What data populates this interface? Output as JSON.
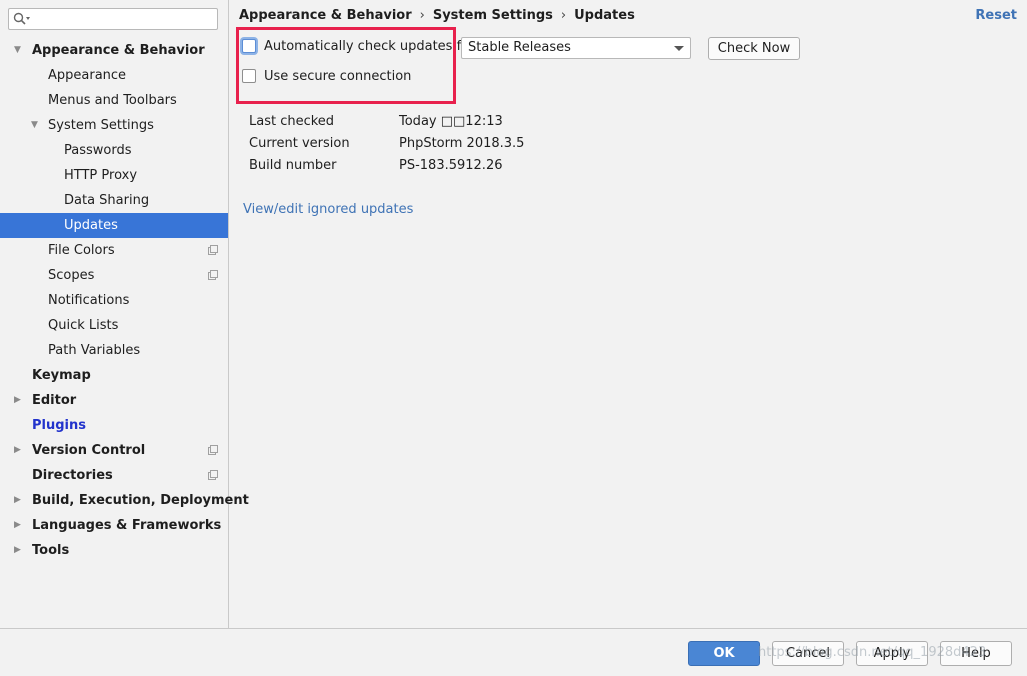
{
  "search": {
    "placeholder": ""
  },
  "sidebar": {
    "items": [
      {
        "label": "Appearance & Behavior",
        "arrow": "▼"
      },
      {
        "label": "Appearance"
      },
      {
        "label": "Menus and Toolbars"
      },
      {
        "label": "System Settings",
        "arrow": "▼"
      },
      {
        "label": "Passwords"
      },
      {
        "label": "HTTP Proxy"
      },
      {
        "label": "Data Sharing"
      },
      {
        "label": "Updates"
      },
      {
        "label": "File Colors"
      },
      {
        "label": "Scopes"
      },
      {
        "label": "Notifications"
      },
      {
        "label": "Quick Lists"
      },
      {
        "label": "Path Variables"
      },
      {
        "label": "Keymap"
      },
      {
        "label": "Editor",
        "arrow": "▶"
      },
      {
        "label": "Plugins"
      },
      {
        "label": "Version Control",
        "arrow": "▶"
      },
      {
        "label": "Directories"
      },
      {
        "label": "Build, Execution, Deployment",
        "arrow": "▶"
      },
      {
        "label": "Languages & Frameworks",
        "arrow": "▶"
      },
      {
        "label": "Tools",
        "arrow": "▶"
      }
    ]
  },
  "breadcrumb": {
    "parts": [
      "Appearance & Behavior",
      "System Settings",
      "Updates"
    ],
    "separator": "›"
  },
  "reset_label": "Reset",
  "updates": {
    "auto_check_label": "Automatically check updates for",
    "auto_check_checked": false,
    "channel_value": "Stable Releases",
    "check_now_label": "Check Now",
    "secure_label": "Use secure connection",
    "secure_checked": false,
    "info": [
      {
        "key": "Last checked",
        "value": "Today □□12:13"
      },
      {
        "key": "Current version",
        "value": "PhpStorm 2018.3.5"
      },
      {
        "key": "Build number",
        "value": "PS-183.5912.26"
      }
    ],
    "ignored_link": "View/edit ignored updates"
  },
  "buttons": {
    "ok": "OK",
    "cancel": "Cancel",
    "apply": "Apply",
    "help": "Help"
  },
  "watermark": "https://blog.csdn.net/qq_1928d423",
  "colors": {
    "selection": "#3875d7",
    "highlight_box": "#e8214d",
    "link": "#3f73b5",
    "primary_button": "#4a86d4"
  }
}
